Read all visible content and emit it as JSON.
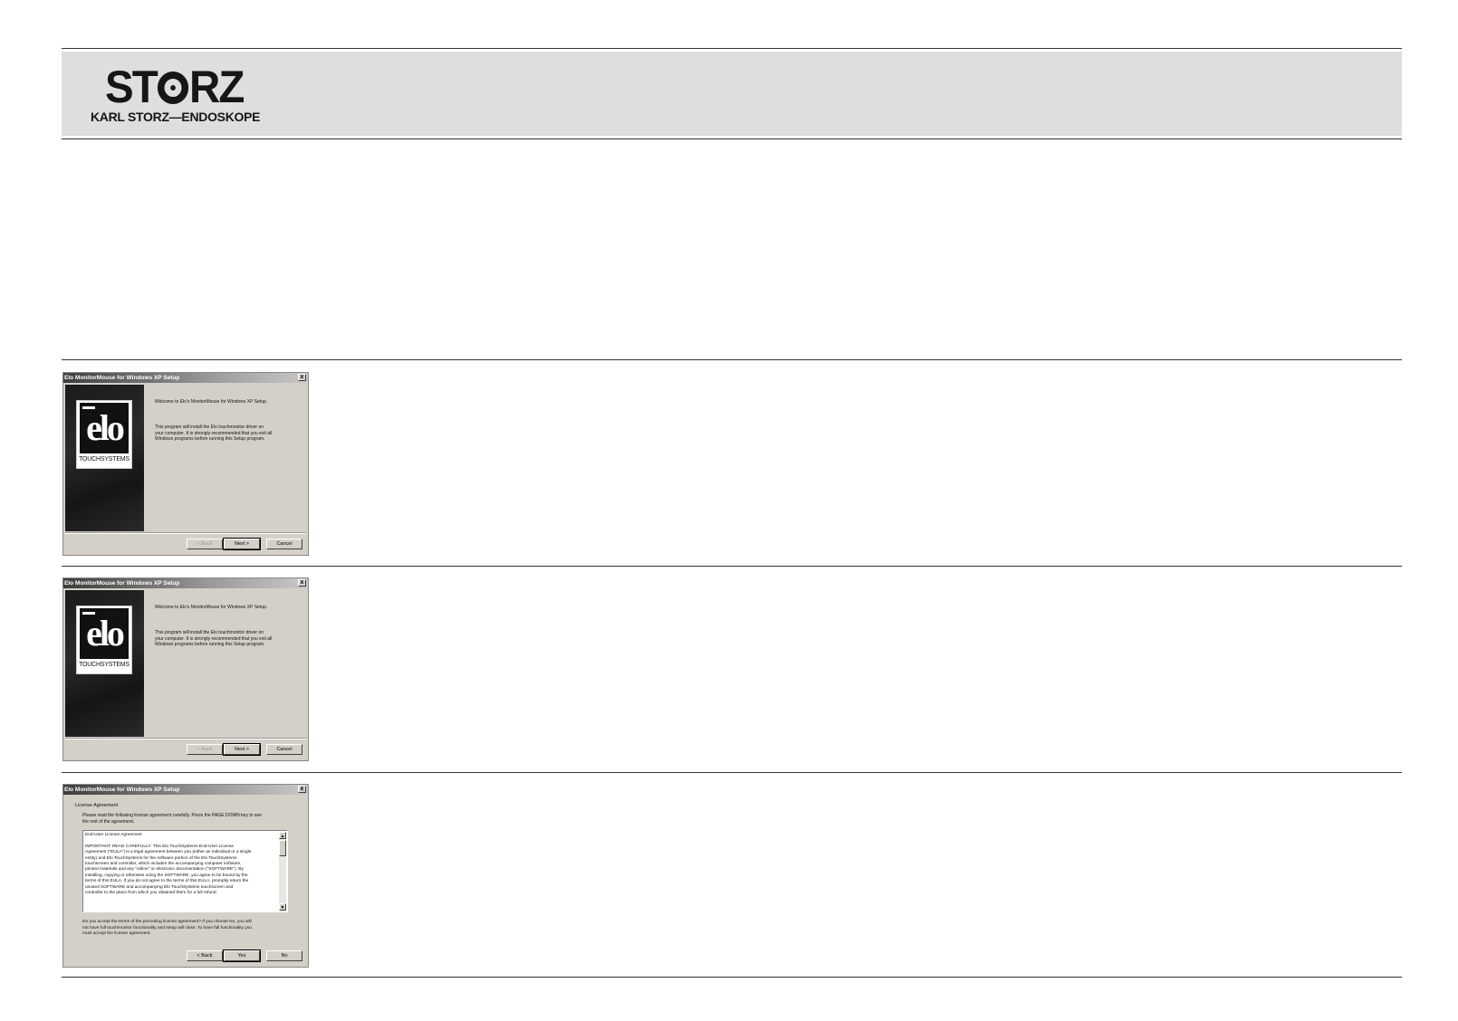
{
  "header": {
    "logo_word_left": "ST",
    "logo_word_right": "RZ",
    "logo_subtitle": "KARL STORZ—ENDOSKOPE"
  },
  "welcome_dialog": {
    "title": "Elo MonitorMouse for Windows XP Setup",
    "close": "x",
    "logo_word": "elo",
    "logo_subtitle": "TOUCHSYSTEMS",
    "welcome_text": "Welcome to Elo's MonitorMouse for Windows XP Setup.",
    "body_text": "This program will install the Elo touchmonitor driver on\nyour computer. It is strongly recommended that you exit all\nWindows programs before running this Setup program.",
    "buttons": {
      "back": "< Back",
      "next": "Next >",
      "cancel": "Cancel"
    }
  },
  "license_dialog": {
    "title": "Elo MonitorMouse for Windows XP Setup",
    "close": "x",
    "heading": "License Agreement",
    "instruction": "Please read the following license agreement carefully. Press the PAGE DOWN key to see\nthe rest of the agreement.",
    "agreement_text": "End-User License Agreement\n\nIMPORTANT: READ CAREFULLY: This Elo TouchSystems End-User License\nAgreement (\"EULA\") is a legal agreement between you (either an individual or a single\nentity) and Elo TouchSystems for the software portion of the Elo TouchSystems\ntouchscreen and controller, which includes the accompanying computer software,\nprinted materials and any \"online\" or electronic documentation (\"SOFTWARE\"). By\ninstalling, copying or otherwise using the SOFTWARE, you agree to be bound by the\nterms of this EULA. If you do not agree to the terms of this EULA, promptly return the\nunused SOFTWARE and accompanying Elo TouchSystems touchscreen and\ncontroller to the place from which you obtained them for a full refund.",
    "question": "Do you accept the terms of the preceding license agreement? If you choose No, you will\nnot have full touchmonitor functionality and setup will close. To have full functionality you\nmust accept the license agreement.",
    "buttons": {
      "back": "< Back",
      "yes": "Yes",
      "no": "No"
    }
  }
}
